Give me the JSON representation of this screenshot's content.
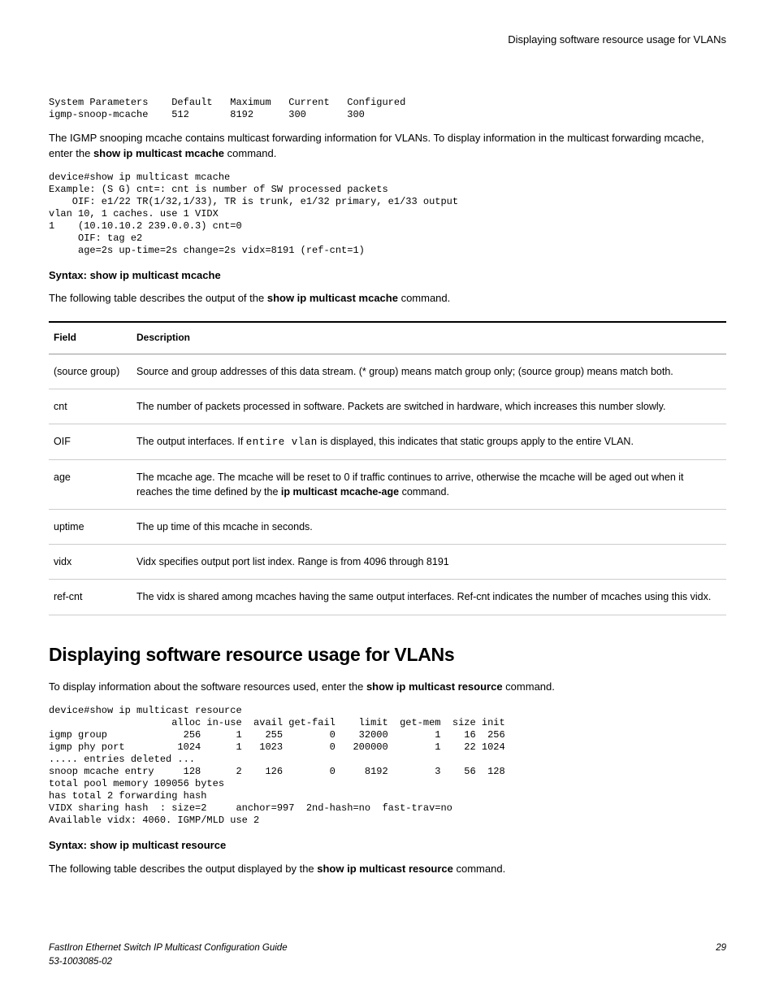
{
  "header": {
    "title": "Displaying software resource usage for VLANs"
  },
  "code1": "System Parameters    Default   Maximum   Current   Configured\nigmp-snoop-mcache    512       8192      300       300",
  "para1_a": "The IGMP snooping mcache contains multicast forwarding information for VLANs. To display information in the multicast forwarding mcache, enter the ",
  "para1_b": "show ip multicast mcache",
  "para1_c": " command.",
  "code2": "device#show ip multicast mcache\nExample: (S G) cnt=: cnt is number of SW processed packets\n    OIF: e1/22 TR(1/32,1/33), TR is trunk, e1/32 primary, e1/33 output\nvlan 10, 1 caches. use 1 VIDX\n1    (10.10.10.2 239.0.0.3) cnt=0\n     OIF: tag e2\n     age=2s up-time=2s change=2s vidx=8191 (ref-cnt=1)",
  "syntax1": "Syntax: show ip multicast mcache",
  "para2_a": "The following table describes the output of the ",
  "para2_b": "show ip multicast mcache",
  "para2_c": " command.",
  "table1": {
    "headers": [
      "Field",
      "Description"
    ],
    "rows": [
      {
        "field": "(source group)",
        "desc": "Source and group addresses of this data stream. (* group) means match group only; (source group) means match both."
      },
      {
        "field": "cnt",
        "desc": "The number of packets processed in software. Packets are switched in hardware, which increases this number slowly."
      },
      {
        "field": "OIF",
        "desc_pre": "The output interfaces. If ",
        "desc_code": "entire vlan",
        "desc_post": " is displayed, this indicates that static groups apply to the entire VLAN."
      },
      {
        "field": "age",
        "desc_pre": "The mcache age. The mcache will be reset to 0 if traffic continues to arrive, otherwise the mcache will be aged out when it reaches the time defined by the ",
        "desc_bold": "ip multicast mcache-age",
        "desc_post": " command."
      },
      {
        "field": "uptime",
        "desc": "The up time of this mcache in seconds."
      },
      {
        "field": "vidx",
        "desc": "Vidx specifies output port list index. Range is from 4096 through 8191"
      },
      {
        "field": "ref-cnt",
        "desc": "The vidx is shared among mcaches having the same output interfaces. Ref-cnt indicates the number of mcaches using this vidx."
      }
    ]
  },
  "h2": "Displaying software resource usage for VLANs",
  "para3_a": "To display information about the software resources used, enter the ",
  "para3_b": "show ip multicast resource",
  "para3_c": " command.",
  "code3": "device#show ip multicast resource\n                     alloc in-use  avail get-fail    limit  get-mem  size init\nigmp group             256      1    255        0    32000        1    16  256\nigmp phy port         1024      1   1023        0   200000        1    22 1024\n..... entries deleted ...\nsnoop mcache entry     128      2    126        0     8192        3    56  128\ntotal pool memory 109056 bytes\nhas total 2 forwarding hash\nVIDX sharing hash  : size=2     anchor=997  2nd-hash=no  fast-trav=no\nAvailable vidx: 4060. IGMP/MLD use 2",
  "syntax2": "Syntax: show ip multicast resource",
  "para4_a": "The following table describes the output displayed by the ",
  "para4_b": "show ip multicast resource",
  "para4_c": " command.",
  "footer": {
    "left1": "FastIron Ethernet Switch IP Multicast Configuration Guide",
    "left2": "53-1003085-02",
    "right": "29"
  }
}
